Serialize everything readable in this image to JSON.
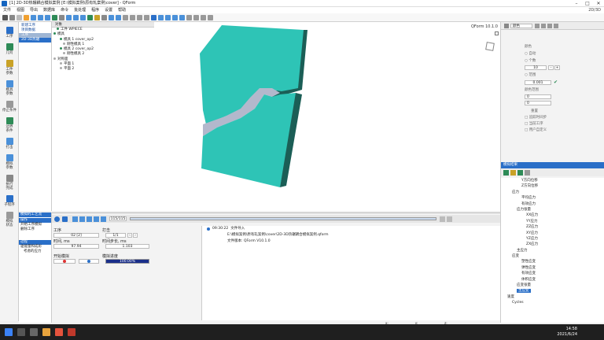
{
  "window": {
    "title": "[1] 2D-3D热辗耦合模拟案例 [E:\\模拟案例\\原有轧案例\\cover] - QForm",
    "dim_label": "2D/3D"
  },
  "menu": [
    "文件",
    "视图",
    "导出",
    "数据库",
    "命令",
    "批处理",
    "程序",
    "设置",
    "帮助"
  ],
  "left_rail": [
    {
      "label": "工序",
      "icon": "process-icon"
    },
    {
      "label": "几何",
      "icon": "geometry-icon"
    },
    {
      "label": "工件\n参数",
      "icon": "workpiece-icon"
    },
    {
      "label": "模具\n参数",
      "icon": "tool-icon"
    },
    {
      "label": "停止条件",
      "icon": "stop-icon"
    },
    {
      "label": "边界\n条件",
      "icon": "boundary-icon"
    },
    {
      "label": "打击",
      "icon": "blow-icon"
    },
    {
      "label": "模拟\n参数",
      "icon": "sim-icon"
    },
    {
      "label": "执行\n完成",
      "icon": "run-icon"
    },
    {
      "label": "子程序",
      "icon": "subroutine-icon"
    },
    {
      "label": "模拟\n状态",
      "icon": "status-icon"
    }
  ],
  "col2": {
    "new_process": "新建工序",
    "project_data": "项目数据",
    "header": "工序",
    "selected": "2D-3D热辗"
  },
  "tree": {
    "header": "对象",
    "nodes": [
      {
        "indent": 1,
        "label": "工件 WPIECE",
        "color": "#2e8b57"
      },
      {
        "indent": 0,
        "label": "模具",
        "color": "#2e8b57"
      },
      {
        "indent": 2,
        "label": "模具 1 cover_op2",
        "color": "#2e8b57"
      },
      {
        "indent": 3,
        "label": "刚性模具 1",
        "color": "#aaa"
      },
      {
        "indent": 2,
        "label": "模具 2 cover_op2",
        "color": "#2e8b57"
      },
      {
        "indent": 3,
        "label": "刚性模具 2",
        "color": "#aaa"
      },
      {
        "indent": 0,
        "label": "对称面",
        "color": "#aaa"
      },
      {
        "indent": 2,
        "label": "平面 1",
        "color": "#aaa"
      },
      {
        "indent": 2,
        "label": "平面 2",
        "color": "#aaa"
      }
    ]
  },
  "viewport": {
    "version": "QForm 10.1.0"
  },
  "playback": {
    "counter": "115/115"
  },
  "process_panel": {
    "header": "模拟的工艺流",
    "op_header": "操作",
    "start_sim": "开始工序模拟",
    "delete_op": "删除工序",
    "section2": "过程",
    "calc_note": "驱能量和成形",
    "calc_sub": "考虑的应力"
  },
  "bottom_fields": {
    "operation_label": "工序",
    "operation_value": "02 [2]",
    "blow_label": "打击",
    "blow_value": "1/1",
    "time_label": "时间, ms",
    "time_value": "97.94",
    "step_time_label": "时间步长, ms",
    "step_time_value": "1.103",
    "start_sim": "开始模拟",
    "progress_label": "模拟进度",
    "progress_value": "100.00%",
    "progress_fraction": 1.0
  },
  "log": {
    "time": "09:30:22",
    "title": "文件导入",
    "line1": "E:\\模拟案例\\原有轧案例\\cover\\2D-3D热辗耦合模拟案例.qform",
    "line2": "文件版本: QForm V10.1.0"
  },
  "right_panel": {
    "toolbar_label": "颜色",
    "opt_title": "颜色",
    "opt_auto": "自动",
    "opt_fixed": "个数",
    "opt_value": "10",
    "opt_range": "范围",
    "opt_range_value": "0.001",
    "opt_scale": "颜色范围",
    "field_a": "0",
    "field_b": "0",
    "reset": "重置",
    "chk1": "追踪时间步",
    "chk2": "当前工序",
    "chk3": "用户自定义",
    "tree_header": "模拟结果",
    "tree_nodes": [
      {
        "indent": 3,
        "label": "Y方向位移"
      },
      {
        "indent": 3,
        "label": "Z方向位移"
      },
      {
        "indent": 1,
        "label": "应力"
      },
      {
        "indent": 3,
        "label": "平均应力"
      },
      {
        "indent": 3,
        "label": "有效应力"
      },
      {
        "indent": 2,
        "label": "应力张量"
      },
      {
        "indent": 4,
        "label": "XX应力"
      },
      {
        "indent": 4,
        "label": "YY应力"
      },
      {
        "indent": 4,
        "label": "ZZ应力"
      },
      {
        "indent": 4,
        "label": "XY应力"
      },
      {
        "indent": 4,
        "label": "YZ应力"
      },
      {
        "indent": 4,
        "label": "ZX应力"
      },
      {
        "indent": 2,
        "label": "主应力"
      },
      {
        "indent": 1,
        "label": "应变"
      },
      {
        "indent": 3,
        "label": "塑性应变"
      },
      {
        "indent": 3,
        "label": "弹性应变"
      },
      {
        "indent": 3,
        "label": "有效应变"
      },
      {
        "indent": 3,
        "label": "体积应变"
      },
      {
        "indent": 2,
        "label": "应变张量"
      },
      {
        "indent": 2,
        "label": "主应变"
      },
      {
        "indent": 0,
        "label": "速度"
      },
      {
        "indent": 1,
        "label": "Cycles"
      }
    ],
    "selected_index": 19
  },
  "statusbar": {
    "x": "x:",
    "y": "y:",
    "z": "z:"
  },
  "taskbar": {
    "time": "14:58",
    "date": "2021/6/24"
  },
  "colors": {
    "workpiece": "#2ec4b6",
    "die_shadow": "#1b5e56",
    "gap": "#b3b8cc",
    "accent": "#2a6fc8",
    "progress": "#1a2f8a"
  }
}
